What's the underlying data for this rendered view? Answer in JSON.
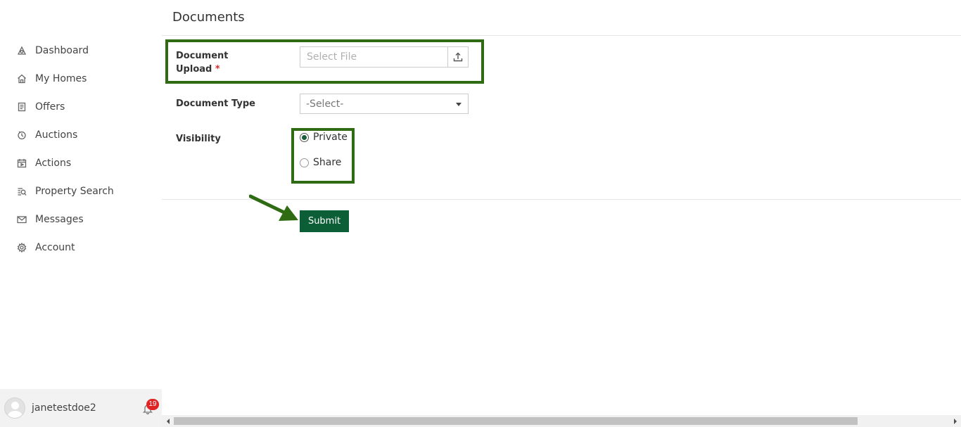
{
  "sidebar": {
    "items": [
      {
        "label": "Dashboard",
        "icon": "dashboard-icon"
      },
      {
        "label": "My Homes",
        "icon": "home-icon"
      },
      {
        "label": "Offers",
        "icon": "offers-icon"
      },
      {
        "label": "Auctions",
        "icon": "auction-icon"
      },
      {
        "label": "Actions",
        "icon": "actions-icon"
      },
      {
        "label": "Property Search",
        "icon": "property-search-icon"
      },
      {
        "label": "Messages",
        "icon": "mail-icon"
      },
      {
        "label": "Account",
        "icon": "gear-icon"
      }
    ],
    "user": {
      "name": "janetestdoe2",
      "notification_count": "19"
    }
  },
  "main": {
    "title": "Documents",
    "form": {
      "upload_label_line1": "Document",
      "upload_label_line2": "Upload",
      "required_mark": "*",
      "upload_placeholder": "Select File",
      "type_label": "Document Type",
      "type_value": "-Select-",
      "visibility_label": "Visibility",
      "visibility_options": [
        {
          "label": "Private",
          "checked": true
        },
        {
          "label": "Share",
          "checked": false
        }
      ],
      "submit_label": "Submit"
    }
  },
  "colors": {
    "highlight": "#2e6b12",
    "submit_bg": "#0b5e35",
    "badge": "#e02424"
  }
}
